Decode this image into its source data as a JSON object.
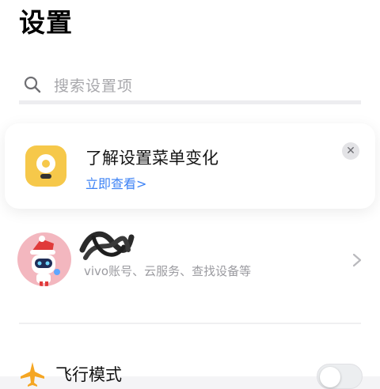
{
  "header": {
    "title": "设置"
  },
  "search": {
    "placeholder": "搜索设置项",
    "icon": "search-icon"
  },
  "tip_card": {
    "title": "了解设置菜单变化",
    "link": "立即查看>",
    "icon": "bulb-icon",
    "close_icon": "close-icon",
    "accent_color": "#f6c84a",
    "link_color": "#3c82f5"
  },
  "account": {
    "subtitle": "vivo账号、云服务、查找设备等",
    "avatar": "robot-avatar",
    "chevron_icon": "chevron-right-icon"
  },
  "settings_items": [
    {
      "label": "飞行模式",
      "icon": "airplane-icon",
      "toggle_on": false
    }
  ]
}
